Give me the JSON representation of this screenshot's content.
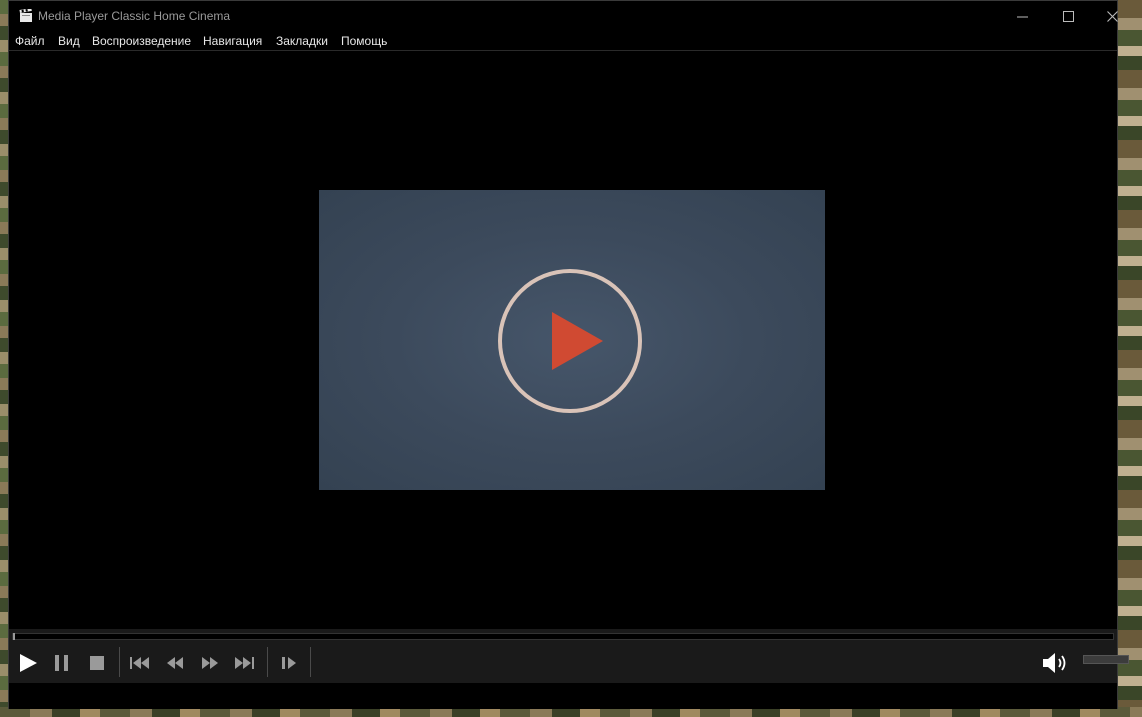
{
  "window": {
    "title": "Media Player Classic Home Cinema"
  },
  "menu": [
    "Файл",
    "Вид",
    "Воспроизведение",
    "Навигация",
    "Закладки",
    "Помощь"
  ],
  "player": {
    "seek_progress": 0.0,
    "volume": 1.0
  },
  "colors": {
    "accent_play": "#d04a32",
    "ring": "#d9c3b8",
    "placeholder": "#3c4a5c"
  },
  "icons": [
    "app-icon",
    "minimize-icon",
    "maximize-icon",
    "close-icon",
    "play-icon",
    "pause-icon",
    "stop-icon",
    "previous-icon",
    "rewind-icon",
    "fast-forward-icon",
    "next-icon",
    "frame-step-icon",
    "volume-icon"
  ]
}
